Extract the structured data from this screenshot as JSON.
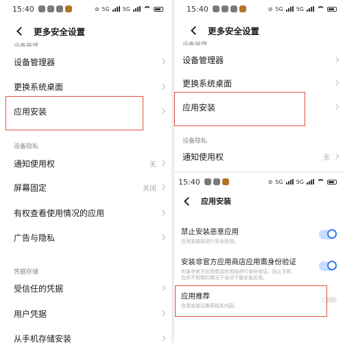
{
  "status": {
    "time": "15:40",
    "net": "5G",
    "net2": "5G"
  },
  "left": {
    "title": "更多安全设置",
    "cut_text": "设备管理",
    "items_top": [
      {
        "label": "设备管理器"
      },
      {
        "label": "更换系统桌面"
      },
      {
        "label": "应用安装"
      }
    ],
    "section_privacy": "设备隐私",
    "privacy_items": [
      {
        "label": "通知使用权",
        "value": "无"
      },
      {
        "label": "屏幕固定",
        "value": "关闭"
      },
      {
        "label": "有权查看使用情况的应用",
        "value": ""
      },
      {
        "label": "广告与隐私",
        "value": ""
      }
    ],
    "section_credentials": "凭据存储",
    "credential_items": [
      {
        "label": "受信任的凭据"
      },
      {
        "label": "用户凭据"
      },
      {
        "label": "从手机存储安装"
      }
    ]
  },
  "right_top": {
    "title": "更多安全设置",
    "cut_text": "设备管理",
    "items": [
      {
        "label": "设备管理器"
      },
      {
        "label": "更换系统桌面"
      },
      {
        "label": "应用安装"
      }
    ],
    "section_privacy": "设备隐私",
    "notify": {
      "label": "通知使用权",
      "value": "无"
    }
  },
  "right_bottom": {
    "title": "应用安装",
    "toggles": [
      {
        "label": "禁止安装恶意应用",
        "sub": "应用安装前进行安全检测。",
        "on": true
      },
      {
        "label": "安装非官方应用商店应用需身份验证",
        "sub": "安装非官方应用商店应用前进行身份验证，防止手机在你不知情的情况下自动下载安装应用。",
        "on": true
      },
      {
        "label": "应用推荐",
        "sub": "应用安装后推荐相关内容。",
        "on": false
      }
    ]
  },
  "colors": {
    "highlight": "#e0503c",
    "toggle_on": "#3a78f2"
  }
}
